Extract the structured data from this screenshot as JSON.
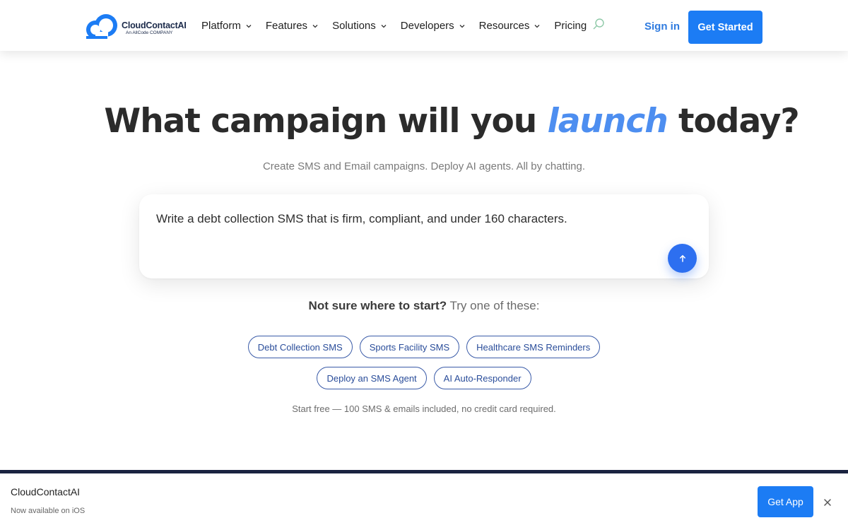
{
  "header": {
    "logo": {
      "name": "CloudContactAI",
      "tagline": "An AllCode COMPANY"
    },
    "nav": [
      {
        "label": "Platform",
        "has_dropdown": true
      },
      {
        "label": "Features",
        "has_dropdown": true
      },
      {
        "label": "Solutions",
        "has_dropdown": true
      },
      {
        "label": "Developers",
        "has_dropdown": true
      },
      {
        "label": "Resources",
        "has_dropdown": true
      },
      {
        "label": "Pricing",
        "has_dropdown": false
      }
    ],
    "search_icon": "search-icon",
    "signin_label": "Sign in",
    "cta_label": "Get Started"
  },
  "hero": {
    "title_before": "What campaign will you",
    "title_accent": "launch",
    "title_after": "today?",
    "subtitle": "Create SMS and Email campaigns. Deploy AI agents. All by chatting."
  },
  "prompt": {
    "value": "Write a debt collection SMS that is firm, compliant, and under 160 characters.",
    "send_icon": "arrow-up-icon"
  },
  "suggestions": {
    "lead_bold": "Not sure where to start?",
    "lead_rest": "Try one of these:",
    "row1": [
      "Debt Collection SMS",
      "Sports Facility SMS",
      "Healthcare SMS Reminders"
    ],
    "row2": [
      "Deploy an SMS Agent",
      "AI Auto-Responder"
    ],
    "footnote": "Start free — 100 SMS & emails included, no credit card required."
  },
  "app_banner": {
    "title": "CloudContactAI",
    "subtitle": "Now available on iOS",
    "button_label": "Get App",
    "close_icon": "close-icon"
  },
  "colors": {
    "accent": "#4d8ef0",
    "primary_button": "#1c7cf4",
    "chip_border": "#3a5ba8",
    "dark_band": "#1a2340"
  }
}
